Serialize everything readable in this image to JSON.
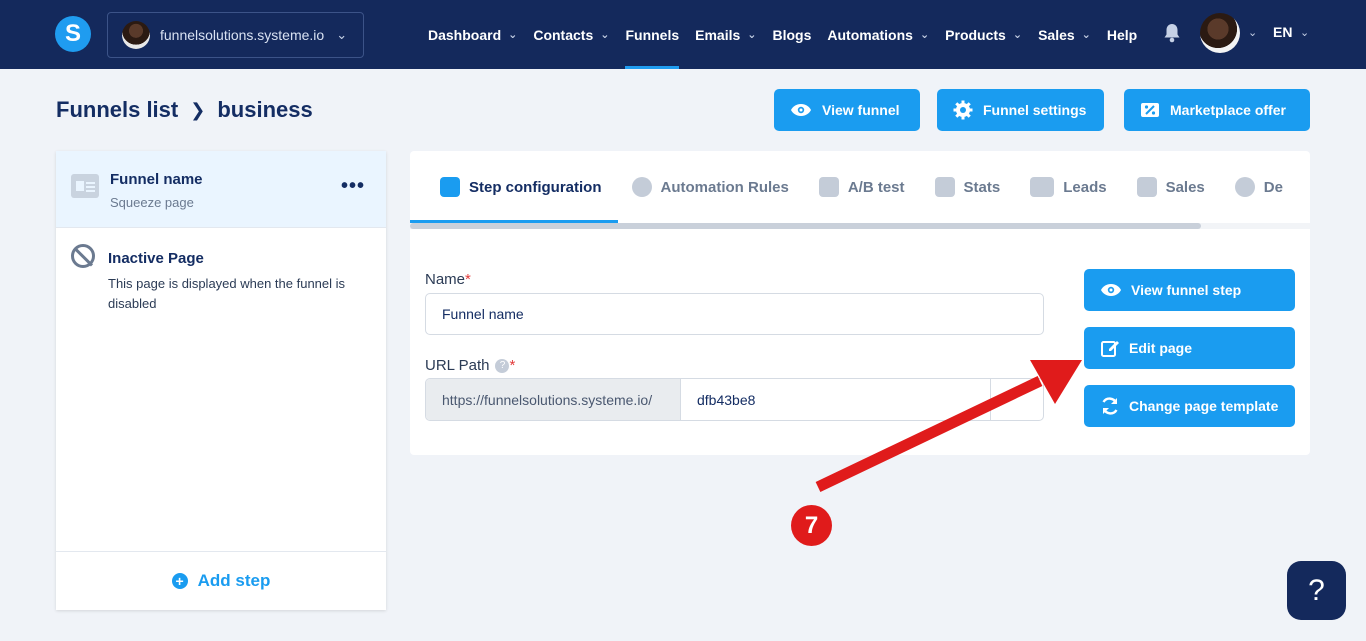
{
  "colors": {
    "nav_bg": "#14295c",
    "accent": "#1a9cf0",
    "annotation": "#e01b1b"
  },
  "header": {
    "logo_letter": "S",
    "workspace": "funnelsolutions.systeme.io",
    "nav": [
      {
        "label": "Dashboard",
        "dropdown": true
      },
      {
        "label": "Contacts",
        "dropdown": true
      },
      {
        "label": "Funnels",
        "dropdown": false,
        "active": true
      },
      {
        "label": "Emails",
        "dropdown": true
      },
      {
        "label": "Blogs",
        "dropdown": false
      },
      {
        "label": "Automations",
        "dropdown": true
      },
      {
        "label": "Products",
        "dropdown": true
      },
      {
        "label": "Sales",
        "dropdown": true
      },
      {
        "label": "Help",
        "dropdown": false
      }
    ],
    "language": "EN"
  },
  "breadcrumb": {
    "parent": "Funnels list",
    "current": "business"
  },
  "actions": {
    "view_funnel": "View funnel",
    "funnel_settings": "Funnel settings",
    "marketplace_offer": "Marketplace offer"
  },
  "steps": {
    "active": {
      "title": "Funnel name",
      "subtitle": "Squeeze page"
    },
    "inactive": {
      "title": "Inactive Page",
      "description": "This page is displayed when the funnel is disabled"
    },
    "add_step": "Add step"
  },
  "tabs": [
    "Step configuration",
    "Automation Rules",
    "A/B test",
    "Stats",
    "Leads",
    "Sales",
    "De"
  ],
  "form": {
    "name_label": "Name",
    "name_value": "Funnel name",
    "url_label": "URL Path",
    "url_prefix": "https://funnelsolutions.systeme.io/",
    "url_value": "dfb43be8",
    "required_mark": "*",
    "help_mark": "?"
  },
  "step_buttons": {
    "view_step": "View funnel step",
    "edit_page": "Edit page",
    "change_template": "Change page template"
  },
  "annotation": {
    "number": "7"
  },
  "help_widget": "?"
}
